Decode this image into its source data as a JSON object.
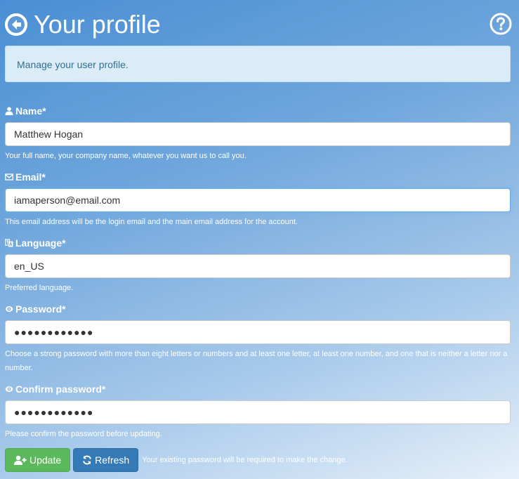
{
  "header": {
    "title": "Your profile"
  },
  "info": {
    "text": "Manage your user profile."
  },
  "fields": {
    "name": {
      "label": "Name*",
      "icon": "user-icon",
      "value": "Matthew Hogan",
      "help": "Your full name, your company name, whatever you want us to call you."
    },
    "email": {
      "label": "Email*",
      "icon": "envelope-icon",
      "value": "iamaperson@email.com",
      "help": "This email address will be the login email and the main email address for the account."
    },
    "language": {
      "label": "Language*",
      "icon": "language-icon",
      "value": "en_US",
      "help": "Preferred language."
    },
    "password": {
      "label": "Password*",
      "icon": "eye-icon",
      "value": "●●●●●●●●●●●●",
      "help": "Choose a strong password with more than eight letters or numbers and at least one letter, at least one number, and one that is neither a letter nor a number."
    },
    "confirm_password": {
      "label": "Confirm password*",
      "icon": "eye-icon",
      "value": "●●●●●●●●●●●●",
      "help": "Please confirm the password before updating."
    }
  },
  "actions": {
    "update_label": "Update",
    "refresh_label": "Refresh",
    "note": "Your existing password will be required to make the change."
  },
  "colors": {
    "update_button": "#5cb85c",
    "refresh_button": "#337ab7",
    "info_background": "#d9ecf8",
    "info_text": "#31708f"
  }
}
